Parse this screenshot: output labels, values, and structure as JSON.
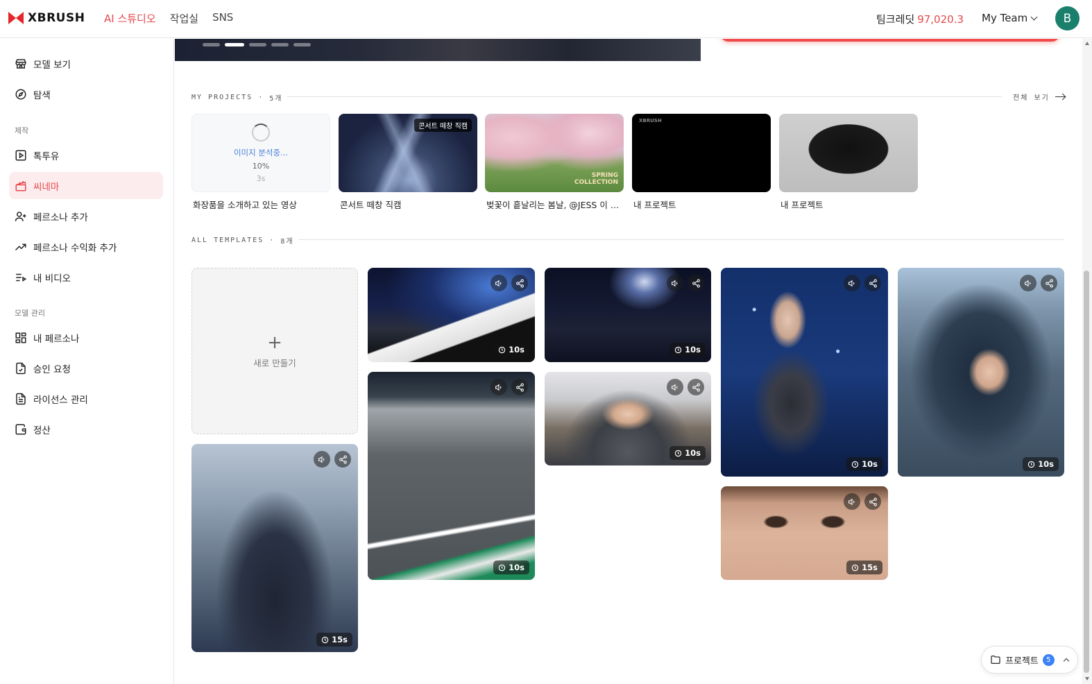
{
  "header": {
    "logo": "XBRUSH",
    "nav": [
      "AI 스튜디오",
      "작업실",
      "SNS"
    ],
    "credit_label": "팀크레딧",
    "credit_amount": "97,020.3",
    "team": "My Team",
    "avatar": "B"
  },
  "sidebar": {
    "items_top": [
      {
        "label": "모델 보기",
        "icon": "store-icon"
      },
      {
        "label": "탐색",
        "icon": "compass-icon"
      }
    ],
    "section_create": "제작",
    "items_create": [
      {
        "label": "톡투유",
        "icon": "play-square-icon"
      },
      {
        "label": "씨네마",
        "icon": "clapperboard-icon"
      },
      {
        "label": "페르소나 추가",
        "icon": "user-plus-icon"
      },
      {
        "label": "페르소나 수익화 추가",
        "icon": "trending-up-icon"
      },
      {
        "label": "내 비디오",
        "icon": "list-video-icon"
      }
    ],
    "section_manage": "모델 관리",
    "items_manage": [
      {
        "label": "내 페르소나",
        "icon": "grid-icon"
      },
      {
        "label": "승인 요청",
        "icon": "file-check-icon"
      },
      {
        "label": "라이선스 관리",
        "icon": "file-text-icon"
      },
      {
        "label": "정산",
        "icon": "wallet-icon"
      }
    ]
  },
  "my_projects": {
    "heading": "MY PROJECTS",
    "count": "5개",
    "see_all": "전체 보기",
    "loading": {
      "text": "이미지 분석중...",
      "percent": "10%",
      "time": "3s"
    },
    "items": [
      {
        "title": "화장품을 소개하고 있는 영상"
      },
      {
        "title": "콘서트 떼창 직캠",
        "tag": "콘서트 떼창 직캠"
      },
      {
        "title": "벚꽃이 흩날리는 봄날, @JESS 이 환...",
        "overlay": "SPRING\nCOLLECTION"
      },
      {
        "title": "내 프로젝트",
        "mini_logo": "XBRUSH"
      },
      {
        "title": "내 프로젝트"
      }
    ]
  },
  "all_templates": {
    "heading": "ALL TEMPLATES",
    "count": "8개",
    "new_label": "새로 만들기",
    "durations": [
      "15s",
      "10s",
      "10s",
      "10s",
      "10s",
      "10s",
      "15s",
      "10s"
    ]
  },
  "project_pill": {
    "label": "프로젝트",
    "count": "5"
  },
  "colors": {
    "accent": "#e5484d",
    "active_bg": "#fdeced",
    "avatar": "#1a7f6b",
    "badge": "#3b82f6"
  }
}
